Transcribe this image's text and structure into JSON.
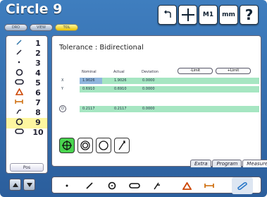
{
  "title": "Circle 9",
  "mode_buttons": [
    "DRO",
    "VIEW",
    "TOL"
  ],
  "toolbar": {
    "m1_label": "M1",
    "mm_label": "mm",
    "help_label": "?"
  },
  "features": [
    {
      "num": "1",
      "icon": "line-icon"
    },
    {
      "num": "2",
      "icon": "line-icon"
    },
    {
      "num": "3",
      "icon": "point-icon"
    },
    {
      "num": "4",
      "icon": "circle-icon"
    },
    {
      "num": "5",
      "icon": "slot-icon"
    },
    {
      "num": "6",
      "icon": "triangle-icon"
    },
    {
      "num": "7",
      "icon": "distance-icon"
    },
    {
      "num": "8",
      "icon": "angle-icon"
    },
    {
      "num": "9",
      "icon": "circle-icon"
    },
    {
      "num": "10",
      "icon": "slot-icon"
    }
  ],
  "pos_label": "Pos",
  "tolerance_title": "Tolerance : Bidirectional",
  "headers": {
    "nominal": "Nominal",
    "actual": "Actual",
    "deviation": "Deviation",
    "llimit": "-Limit",
    "ulimit": "+Limit"
  },
  "rows": [
    {
      "label": "X",
      "nominal": "1.9026",
      "actual": "1.9026",
      "deviation": "0.0000"
    },
    {
      "label": "Y",
      "nominal": "0.6910",
      "actual": "0.6910",
      "deviation": "0.0000"
    },
    {
      "label": "D",
      "nominal": "0.2117",
      "actual": "0.2117",
      "deviation": "0.0000"
    }
  ],
  "tabs": [
    "Extra",
    "Program",
    "Measure"
  ],
  "colors": {
    "accent": "#3b79ba",
    "row": "#a6e6c2",
    "highlight": "#8fb6dd",
    "tool_active": "#49d44f"
  }
}
